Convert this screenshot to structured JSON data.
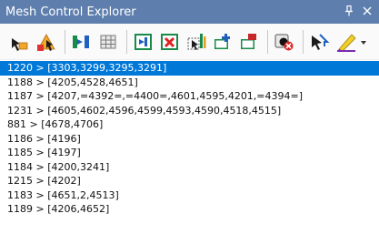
{
  "panel": {
    "title": "Mesh Control Explorer",
    "pin_glyph": "ȩ",
    "close_glyph": "✕"
  },
  "toolbar": {
    "icons": [
      "select-arrow-icon",
      "select-mesh-icon",
      "add-elements-icon",
      "grid-table-icon",
      "add-to-group-icon",
      "remove-from-group-icon",
      "select-cells-icon",
      "add-group-icon",
      "remove-group-icon",
      "delete-icon",
      "pick-arrow-icon",
      "highlight-icon"
    ]
  },
  "colors": {
    "title_bar": "#5e7fae",
    "selection": "#0078d7"
  },
  "rows": [
    {
      "text": "1220 > [3303,3299,3295,3291]",
      "selected": true
    },
    {
      "text": "1188 > [4205,4528,4651]",
      "selected": false
    },
    {
      "text": "1187 > [4207,=4392=,=4400=,4601,4595,4201,=4394=]",
      "selected": false
    },
    {
      "text": "1231 > [4605,4602,4596,4599,4593,4590,4518,4515]",
      "selected": false
    },
    {
      "text": "881 > [4678,4706]",
      "selected": false
    },
    {
      "text": "1186 > [4196]",
      "selected": false
    },
    {
      "text": "1185 > [4197]",
      "selected": false
    },
    {
      "text": "1184 > [4200,3241]",
      "selected": false
    },
    {
      "text": "1215 > [4202]",
      "selected": false
    },
    {
      "text": "1183 > [4651,2,4513]",
      "selected": false
    },
    {
      "text": "1189 > [4206,4652]",
      "selected": false
    }
  ]
}
